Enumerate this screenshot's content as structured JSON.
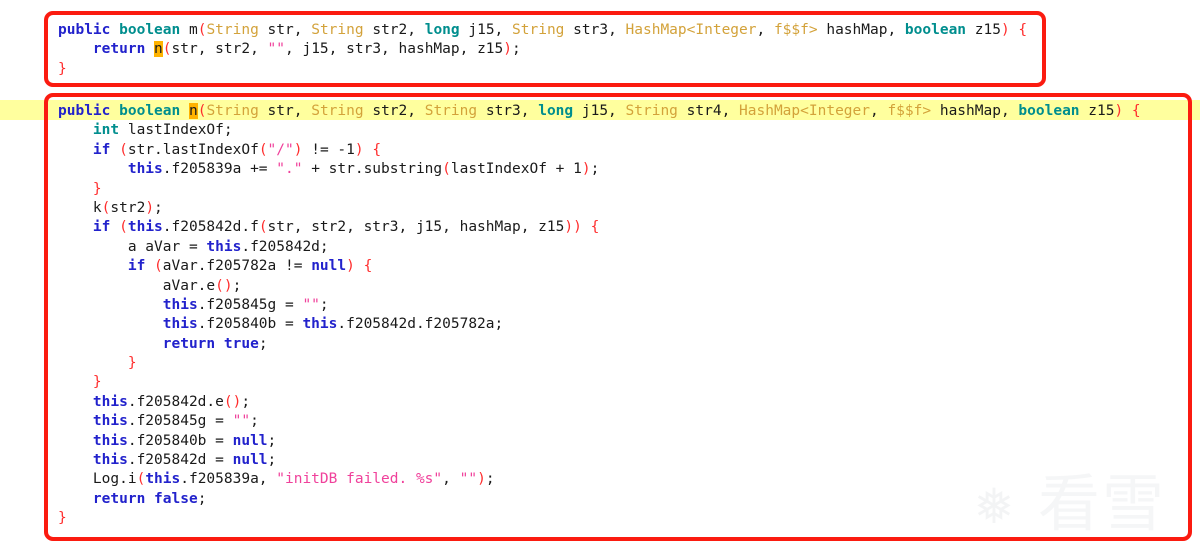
{
  "viewer": {
    "title": "decompiled-java-code-viewer",
    "background_color": "#ffffff",
    "font_size_px": 14.5,
    "highlight_line_color": "#ffff9e",
    "annotation_border_color": "#fb1b10",
    "identifier_highlight_color": "#ffb300"
  },
  "watermark": {
    "flake_glyph": "❅",
    "text": "看雪"
  },
  "annotations": [
    {
      "name": "caller-method-box",
      "label": "m-method-outline"
    },
    {
      "name": "callee-method-box",
      "label": "n-method-outline"
    }
  ],
  "syntax_colors": {
    "keyword": "#2222cc",
    "type": "#008e8e",
    "class_name": "#d3a23a",
    "identifier": "#1a1a1a",
    "punctuation": "#ff2d2d",
    "string": "#f0419b"
  },
  "caller_method": {
    "name": "m",
    "lines": [
      [
        {
          "t": "public",
          "c": "kw"
        },
        {
          "t": " ",
          "c": "plain"
        },
        {
          "t": "boolean",
          "c": "type"
        },
        {
          "t": " ",
          "c": "plain"
        },
        {
          "t": "m",
          "c": "method"
        },
        {
          "t": "(",
          "c": "punc"
        },
        {
          "t": "String",
          "c": "class"
        },
        {
          "t": " str, ",
          "c": "plain"
        },
        {
          "t": "String",
          "c": "class"
        },
        {
          "t": " str2, ",
          "c": "plain"
        },
        {
          "t": "long",
          "c": "type"
        },
        {
          "t": " j15, ",
          "c": "plain"
        },
        {
          "t": "String",
          "c": "class"
        },
        {
          "t": " str3, ",
          "c": "plain"
        },
        {
          "t": "HashMap",
          "c": "class"
        },
        {
          "t": "<",
          "c": "class"
        },
        {
          "t": "Integer",
          "c": "class"
        },
        {
          "t": ", ",
          "c": "plain"
        },
        {
          "t": "f$$f",
          "c": "class"
        },
        {
          "t": ">",
          "c": "class"
        },
        {
          "t": " hashMap, ",
          "c": "plain"
        },
        {
          "t": "boolean",
          "c": "type"
        },
        {
          "t": " z15",
          "c": "plain"
        },
        {
          "t": ")",
          "c": "punc"
        },
        {
          "t": " ",
          "c": "plain"
        },
        {
          "t": "{",
          "c": "punc"
        }
      ],
      [
        {
          "t": "    ",
          "c": "plain"
        },
        {
          "t": "return",
          "c": "kw"
        },
        {
          "t": " ",
          "c": "plain"
        },
        {
          "t": "n",
          "c": "hl"
        },
        {
          "t": "(",
          "c": "punc"
        },
        {
          "t": "str, str2, ",
          "c": "plain"
        },
        {
          "t": "\"\"",
          "c": "str"
        },
        {
          "t": ", j15, str3, hashMap, z15",
          "c": "plain"
        },
        {
          "t": ")",
          "c": "punc"
        },
        {
          "t": ";",
          "c": "plain"
        }
      ],
      [
        {
          "t": "}",
          "c": "punc"
        }
      ]
    ]
  },
  "callee_method": {
    "name": "n",
    "highlighted_signature": true,
    "lines": [
      [
        {
          "t": "public",
          "c": "kw"
        },
        {
          "t": " ",
          "c": "plain"
        },
        {
          "t": "boolean",
          "c": "type"
        },
        {
          "t": " ",
          "c": "plain"
        },
        {
          "t": "n",
          "c": "hl"
        },
        {
          "t": "(",
          "c": "punc"
        },
        {
          "t": "String",
          "c": "class"
        },
        {
          "t": " str, ",
          "c": "plain"
        },
        {
          "t": "String",
          "c": "class"
        },
        {
          "t": " str2, ",
          "c": "plain"
        },
        {
          "t": "String",
          "c": "class"
        },
        {
          "t": " str3, ",
          "c": "plain"
        },
        {
          "t": "long",
          "c": "type"
        },
        {
          "t": " j15, ",
          "c": "plain"
        },
        {
          "t": "String",
          "c": "class"
        },
        {
          "t": " str4, ",
          "c": "plain"
        },
        {
          "t": "HashMap",
          "c": "class"
        },
        {
          "t": "<",
          "c": "class"
        },
        {
          "t": "Integer",
          "c": "class"
        },
        {
          "t": ", ",
          "c": "plain"
        },
        {
          "t": "f$$f",
          "c": "class"
        },
        {
          "t": ">",
          "c": "class"
        },
        {
          "t": " hashMap, ",
          "c": "plain"
        },
        {
          "t": "boolean",
          "c": "type"
        },
        {
          "t": " z15",
          "c": "plain"
        },
        {
          "t": ")",
          "c": "punc"
        },
        {
          "t": " ",
          "c": "plain"
        },
        {
          "t": "{",
          "c": "punc"
        }
      ],
      [
        {
          "t": "    ",
          "c": "plain"
        },
        {
          "t": "int",
          "c": "type"
        },
        {
          "t": " lastIndexOf;",
          "c": "plain"
        }
      ],
      [
        {
          "t": "    ",
          "c": "plain"
        },
        {
          "t": "if",
          "c": "kw"
        },
        {
          "t": " ",
          "c": "plain"
        },
        {
          "t": "(",
          "c": "punc"
        },
        {
          "t": "str.lastIndexOf",
          "c": "plain"
        },
        {
          "t": "(",
          "c": "punc"
        },
        {
          "t": "\"/\"",
          "c": "str"
        },
        {
          "t": ")",
          "c": "punc"
        },
        {
          "t": " != -1",
          "c": "plain"
        },
        {
          "t": ")",
          "c": "punc"
        },
        {
          "t": " ",
          "c": "plain"
        },
        {
          "t": "{",
          "c": "punc"
        }
      ],
      [
        {
          "t": "        ",
          "c": "plain"
        },
        {
          "t": "this",
          "c": "this"
        },
        {
          "t": ".f205839a += ",
          "c": "plain"
        },
        {
          "t": "\".\"",
          "c": "str"
        },
        {
          "t": " + str.substring",
          "c": "plain"
        },
        {
          "t": "(",
          "c": "punc"
        },
        {
          "t": "lastIndexOf + 1",
          "c": "plain"
        },
        {
          "t": ")",
          "c": "punc"
        },
        {
          "t": ";",
          "c": "plain"
        }
      ],
      [
        {
          "t": "    ",
          "c": "plain"
        },
        {
          "t": "}",
          "c": "punc"
        }
      ],
      [
        {
          "t": "    ",
          "c": "plain"
        },
        {
          "t": "k",
          "c": "plain"
        },
        {
          "t": "(",
          "c": "punc"
        },
        {
          "t": "str2",
          "c": "plain"
        },
        {
          "t": ")",
          "c": "punc"
        },
        {
          "t": ";",
          "c": "plain"
        }
      ],
      [
        {
          "t": "    ",
          "c": "plain"
        },
        {
          "t": "if",
          "c": "kw"
        },
        {
          "t": " ",
          "c": "plain"
        },
        {
          "t": "(",
          "c": "punc"
        },
        {
          "t": "this",
          "c": "this"
        },
        {
          "t": ".f205842d.f",
          "c": "plain"
        },
        {
          "t": "(",
          "c": "punc"
        },
        {
          "t": "str, str2, str3, j15, hashMap, z15",
          "c": "plain"
        },
        {
          "t": ")",
          "c": "punc"
        },
        {
          "t": ")",
          "c": "punc"
        },
        {
          "t": " ",
          "c": "plain"
        },
        {
          "t": "{",
          "c": "punc"
        }
      ],
      [
        {
          "t": "        ",
          "c": "plain"
        },
        {
          "t": "a aVar = ",
          "c": "plain"
        },
        {
          "t": "this",
          "c": "this"
        },
        {
          "t": ".f205842d;",
          "c": "plain"
        }
      ],
      [
        {
          "t": "        ",
          "c": "plain"
        },
        {
          "t": "if",
          "c": "kw"
        },
        {
          "t": " ",
          "c": "plain"
        },
        {
          "t": "(",
          "c": "punc"
        },
        {
          "t": "aVar.f205782a != ",
          "c": "plain"
        },
        {
          "t": "null",
          "c": "this"
        },
        {
          "t": ")",
          "c": "punc"
        },
        {
          "t": " ",
          "c": "plain"
        },
        {
          "t": "{",
          "c": "punc"
        }
      ],
      [
        {
          "t": "            ",
          "c": "plain"
        },
        {
          "t": "aVar.e",
          "c": "plain"
        },
        {
          "t": "(",
          "c": "punc"
        },
        {
          "t": ")",
          "c": "punc"
        },
        {
          "t": ";",
          "c": "plain"
        }
      ],
      [
        {
          "t": "            ",
          "c": "plain"
        },
        {
          "t": "this",
          "c": "this"
        },
        {
          "t": ".f205845g = ",
          "c": "plain"
        },
        {
          "t": "\"\"",
          "c": "str"
        },
        {
          "t": ";",
          "c": "plain"
        }
      ],
      [
        {
          "t": "            ",
          "c": "plain"
        },
        {
          "t": "this",
          "c": "this"
        },
        {
          "t": ".f205840b = ",
          "c": "plain"
        },
        {
          "t": "this",
          "c": "this"
        },
        {
          "t": ".f205842d.f205782a;",
          "c": "plain"
        }
      ],
      [
        {
          "t": "            ",
          "c": "plain"
        },
        {
          "t": "return",
          "c": "kw"
        },
        {
          "t": " ",
          "c": "plain"
        },
        {
          "t": "true",
          "c": "this"
        },
        {
          "t": ";",
          "c": "plain"
        }
      ],
      [
        {
          "t": "        ",
          "c": "plain"
        },
        {
          "t": "}",
          "c": "punc"
        }
      ],
      [
        {
          "t": "    ",
          "c": "plain"
        },
        {
          "t": "}",
          "c": "punc"
        }
      ],
      [
        {
          "t": "    ",
          "c": "plain"
        },
        {
          "t": "this",
          "c": "this"
        },
        {
          "t": ".f205842d.e",
          "c": "plain"
        },
        {
          "t": "(",
          "c": "punc"
        },
        {
          "t": ")",
          "c": "punc"
        },
        {
          "t": ";",
          "c": "plain"
        }
      ],
      [
        {
          "t": "    ",
          "c": "plain"
        },
        {
          "t": "this",
          "c": "this"
        },
        {
          "t": ".f205845g = ",
          "c": "plain"
        },
        {
          "t": "\"\"",
          "c": "str"
        },
        {
          "t": ";",
          "c": "plain"
        }
      ],
      [
        {
          "t": "    ",
          "c": "plain"
        },
        {
          "t": "this",
          "c": "this"
        },
        {
          "t": ".f205840b = ",
          "c": "plain"
        },
        {
          "t": "null",
          "c": "this"
        },
        {
          "t": ";",
          "c": "plain"
        }
      ],
      [
        {
          "t": "    ",
          "c": "plain"
        },
        {
          "t": "this",
          "c": "this"
        },
        {
          "t": ".f205842d = ",
          "c": "plain"
        },
        {
          "t": "null",
          "c": "this"
        },
        {
          "t": ";",
          "c": "plain"
        }
      ],
      [
        {
          "t": "    ",
          "c": "plain"
        },
        {
          "t": "Log.i",
          "c": "plain"
        },
        {
          "t": "(",
          "c": "punc"
        },
        {
          "t": "this",
          "c": "this"
        },
        {
          "t": ".f205839a, ",
          "c": "plain"
        },
        {
          "t": "\"initDB failed. %s\"",
          "c": "str"
        },
        {
          "t": ", ",
          "c": "plain"
        },
        {
          "t": "\"\"",
          "c": "str"
        },
        {
          "t": ")",
          "c": "punc"
        },
        {
          "t": ";",
          "c": "plain"
        }
      ],
      [
        {
          "t": "    ",
          "c": "plain"
        },
        {
          "t": "return",
          "c": "kw"
        },
        {
          "t": " ",
          "c": "plain"
        },
        {
          "t": "false",
          "c": "this"
        },
        {
          "t": ";",
          "c": "plain"
        }
      ],
      [
        {
          "t": "}",
          "c": "punc"
        }
      ]
    ]
  }
}
